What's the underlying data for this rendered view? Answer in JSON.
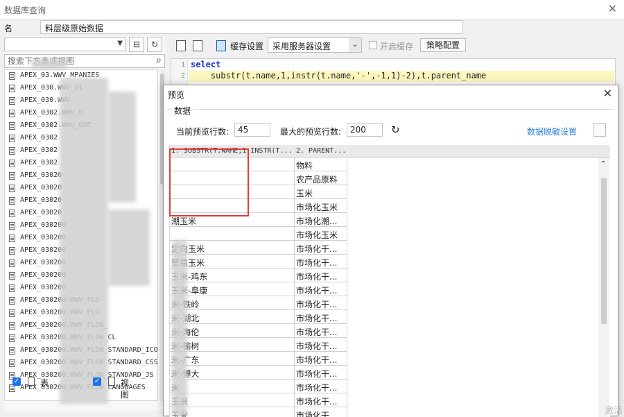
{
  "window": {
    "title": "数据库查询",
    "close_glyph": "✕"
  },
  "name_row": {
    "label": "名",
    "value": "料层级原始数据"
  },
  "left": {
    "search_placeholder": "搜索下方表或视图",
    "items": [
      "APEX_03.WWV_MPANIES",
      "APEX_030.WWV_VI",
      "APEX_030.WWV_",
      "APEX_0302.WWV_D",
      "APEX_0302.WWV_OVE",
      "APEX_0302",
      "APEX_0302",
      "APEX_0302",
      "APEX_03020",
      "APEX_03020",
      "APEX_03020",
      "APEX_03020",
      "APEX_030200",
      "APEX_030200",
      "APEX_030200",
      "APEX_030200",
      "APEX_030200",
      "APEX_030200",
      "APEX_030200.WWV_FLO",
      "APEX_030200.WWV_FLO",
      "APEX_030200.WWV_FLOW_",
      "APEX_030200.WWV_FLOW_CL",
      "APEX_030200.WWV_FLOW_STANDARD_ICO",
      "APEX_030200.WWV_FLOW_STANDARD_CSS",
      "APEX_030200.WWV_FLOW_STANDARD_JS",
      "APEX_030200.WWV_FLOW_LANGUAGES"
    ],
    "check_table": "表",
    "check_view": "视图"
  },
  "toolbar": {
    "cache_label": "缓存设置",
    "cache_value": "采用服务器设置",
    "enable_cache": "开启缓存",
    "policy_button": "策略配置"
  },
  "editor": {
    "line_numbers": [
      "1",
      "2"
    ],
    "kw_select": "select",
    "line2_pre": "    substr(t.name,1,instr(t.name,",
    "line2_str": "'-'",
    "line2_post": ",-1,1)-2),t.parent_name"
  },
  "preview": {
    "title": "预览",
    "group_label": "数据",
    "current_rows_label": "当前预览行数:",
    "current_rows_value": "45",
    "max_rows_label": "最大的预览行数:",
    "max_rows_value": "200",
    "mask_link": "数据脱敏设置",
    "columns": [
      "1. SUBSTR(T.NAME,1,INSTR(T...",
      "2. PARENT..."
    ],
    "rows": [
      [
        "",
        "物料"
      ],
      [
        "",
        "农产品原料"
      ],
      [
        "",
        "玉米"
      ],
      [
        "",
        "市场化玉米"
      ],
      [
        "潮玉米",
        "市场化潮..."
      ],
      [
        "",
        "市场化玉米"
      ],
      [
        "定向玉米",
        "市场化干..."
      ],
      [
        "贸易玉米",
        "市场化干..."
      ],
      [
        "玉米-鸡东",
        "市场化干..."
      ],
      [
        "玉米-阜康",
        "市场化干..."
      ],
      [
        "米-铁岭",
        "市场化干..."
      ],
      [
        "米-湖北",
        "市场化干..."
      ],
      [
        "米-海伦",
        "市场化干..."
      ],
      [
        "米-榆树",
        "市场化干..."
      ],
      [
        "米-广东",
        "市场化干..."
      ],
      [
        "米-博大",
        "市场化干..."
      ],
      [
        "米",
        "市场化干..."
      ],
      [
        "玉米",
        "市场化干..."
      ],
      [
        "玉米",
        "市场化干..."
      ]
    ]
  },
  "watermark": "激活"
}
